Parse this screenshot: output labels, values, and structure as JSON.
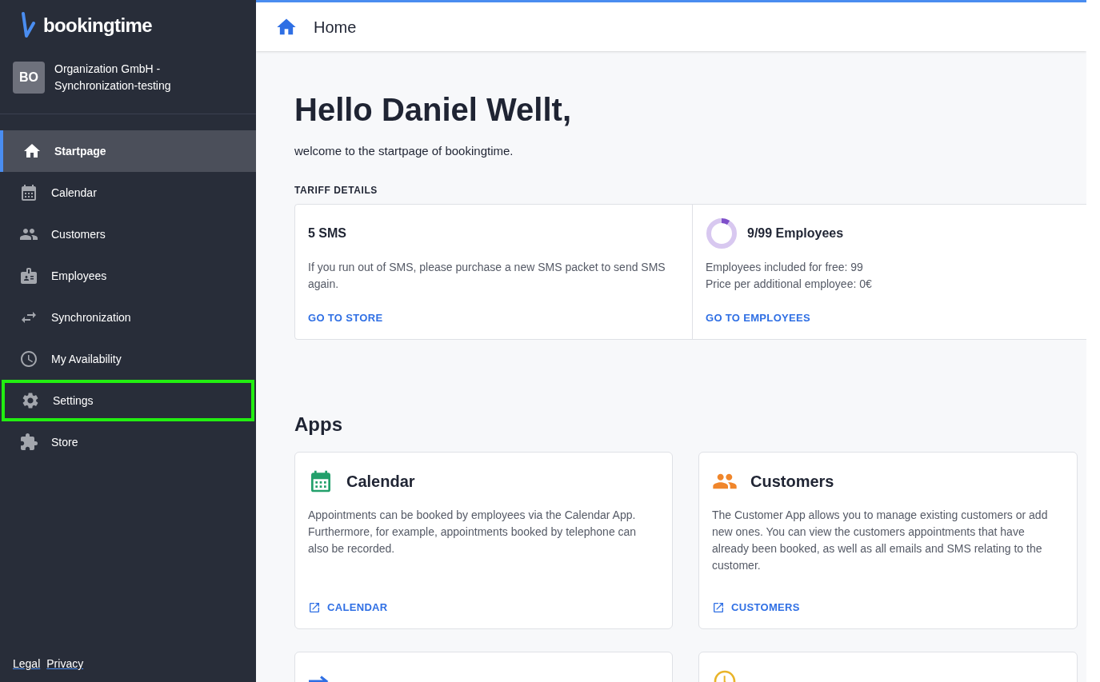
{
  "brand": {
    "name": "bookingtime"
  },
  "organization": {
    "initials": "BO",
    "name": "Organization GmbH - Synchronization-testing"
  },
  "sidebar": {
    "items": [
      {
        "label": "Startpage",
        "selected": true,
        "highlighted": false
      },
      {
        "label": "Calendar",
        "selected": false,
        "highlighted": false
      },
      {
        "label": "Customers",
        "selected": false,
        "highlighted": false
      },
      {
        "label": "Employees",
        "selected": false,
        "highlighted": false
      },
      {
        "label": "Synchronization",
        "selected": false,
        "highlighted": false
      },
      {
        "label": "My Availability",
        "selected": false,
        "highlighted": false
      },
      {
        "label": "Settings",
        "selected": false,
        "highlighted": true
      },
      {
        "label": "Store",
        "selected": false,
        "highlighted": false
      }
    ],
    "footer_links": [
      "Legal",
      "Privacy"
    ]
  },
  "topbar": {
    "title": "Home"
  },
  "greeting": {
    "title": "Hello Daniel Wellt,",
    "subtitle": "welcome to the startpage of bookingtime."
  },
  "tariff": {
    "heading": "TARIFF DETAILS",
    "cards": [
      {
        "kind": "text",
        "title": "5 SMS",
        "lines": [
          "If you run out of SMS, please purchase a new SMS packet to send SMS again."
        ],
        "link": "GO TO STORE"
      },
      {
        "kind": "meter",
        "title": "9/99 Employees",
        "level": 0.09,
        "lines": [
          "Employees included for free: 99",
          "Price per additional employee: 0€"
        ],
        "link": "GO TO EMPLOYEES"
      }
    ]
  },
  "apps": {
    "heading": "Apps",
    "cards": [
      {
        "color": "#22a06b",
        "title": "Calendar",
        "description": "Appointments can be booked by employees via the Calendar App. Furthermore, for example, appointments booked by telephone can also be recorded.",
        "link": "CALENDAR"
      },
      {
        "color": "#f0862b",
        "title": "Customers",
        "description": "The Customer App allows you to manage existing customers or add new ones. You can view the customers appointments that have already been booked, as well as all emails and SMS relating to the customer.",
        "link": "CUSTOMERS"
      },
      {
        "color": "#2f6fe4"
      },
      {
        "color": "#e9b429"
      }
    ]
  }
}
